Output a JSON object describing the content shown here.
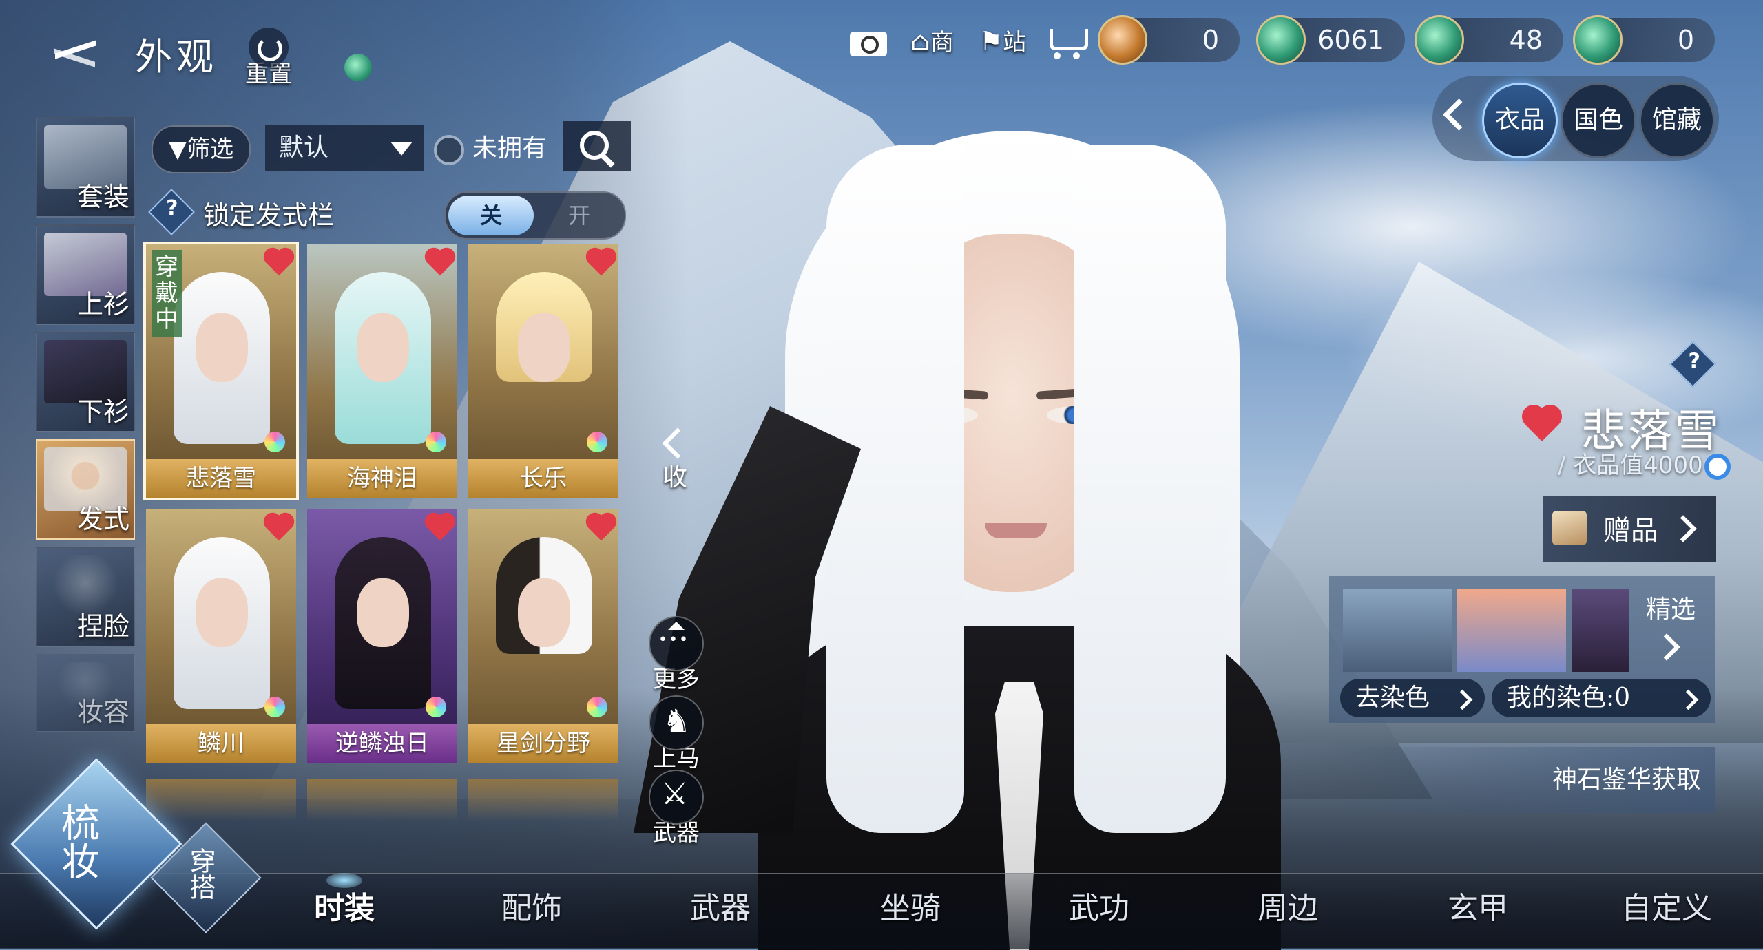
{
  "header": {
    "title": "外观",
    "reset_label": "重置"
  },
  "categories": [
    {
      "label": "套装",
      "active": false
    },
    {
      "label": "上衫",
      "active": false
    },
    {
      "label": "下衫",
      "active": false
    },
    {
      "label": "发式",
      "active": true
    },
    {
      "label": "捏脸",
      "active": false
    },
    {
      "label": "妆容",
      "active": false
    }
  ],
  "filter": {
    "filter_label": "筛选",
    "sort_value": "默认",
    "unowned_label": "未拥有"
  },
  "lock_row": {
    "help_glyph": "?",
    "label": "锁定发式栏",
    "off_label": "关",
    "on_label": "开",
    "state": "off"
  },
  "items": [
    {
      "name": "悲落雪",
      "selected": true,
      "wearing_label": "穿戴中"
    },
    {
      "name": "海神泪"
    },
    {
      "name": "长乐"
    },
    {
      "name": "鳞川"
    },
    {
      "name": "逆鳞浊日"
    },
    {
      "name": "星剑分野"
    }
  ],
  "side_controls": {
    "collapse_label": "收",
    "more_label": "更多",
    "mount_label": "上马",
    "weapon_label": "武器"
  },
  "toolbar": {
    "shop_label": "商",
    "station_label": "站"
  },
  "currencies": [
    {
      "value": "0",
      "icon": "jade-gold-coin-icon"
    },
    {
      "value": "6061",
      "icon": "jade-coin-icon"
    },
    {
      "value": "48",
      "icon": "jade-coin-icon"
    },
    {
      "value": "0",
      "icon": "jade-coin-icon"
    }
  ],
  "right_tabs": [
    {
      "label": "衣品",
      "active": true
    },
    {
      "label": "国色",
      "active": false
    },
    {
      "label": "馆藏",
      "active": false
    }
  ],
  "info": {
    "help_glyph": "?",
    "name": "悲落雪",
    "value_prefix": "/ ",
    "value_text": "衣品值4000",
    "gift_label": "赠品",
    "featured_label": "精选",
    "remove_dye_label": "去染色",
    "my_dye_label": "我的染色:0",
    "stone_label": "神石鉴华获取"
  },
  "bottom_tabs": [
    {
      "label": "时装",
      "active": true
    },
    {
      "label": "配饰",
      "active": false
    },
    {
      "label": "武器",
      "active": false
    },
    {
      "label": "坐骑",
      "active": false
    },
    {
      "label": "武功",
      "active": false
    },
    {
      "label": "周边",
      "active": false
    },
    {
      "label": "玄甲",
      "active": false
    },
    {
      "label": "自定义",
      "active": false
    }
  ],
  "modes": {
    "main_label": "梳妆",
    "sub_label": "穿搭"
  },
  "colors": {
    "accent_gold": "#b5832e",
    "heart_red": "#e23a48",
    "active_blue": "#6ab4ff"
  }
}
